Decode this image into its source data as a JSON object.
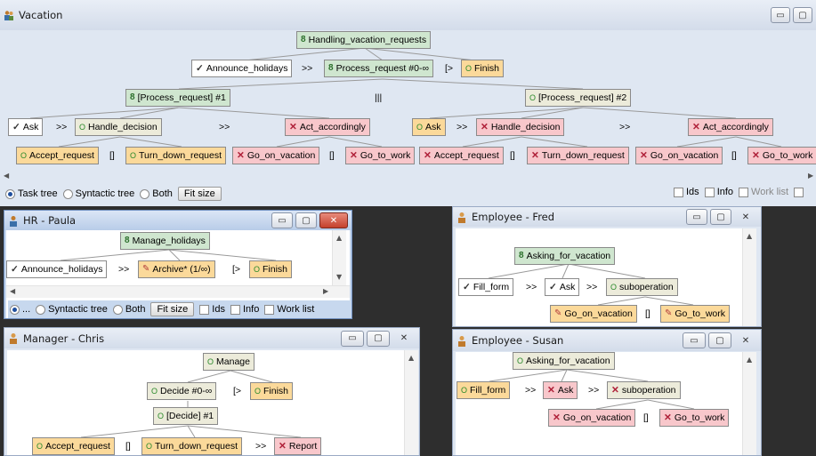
{
  "vacation": {
    "title": "Vacation",
    "controls": {
      "minimize": "▭",
      "maximize": "▢"
    },
    "nodes": {
      "root": "Handling_vacation_requests",
      "announce": "Announce_holidays",
      "op1": ">>",
      "process_request": "Process_request #0-∞",
      "op2": "[>",
      "finish": "Finish",
      "pr1": "[Process_request] #1",
      "parallel": "|||",
      "pr2": "[Process_request] #2",
      "ask1": "Ask",
      "op3": ">>",
      "handle1": "Handle_decision",
      "op4": ">>",
      "act1": "Act_accordingly",
      "ask2": "Ask",
      "op5": ">>",
      "handle2": "Handle_decision",
      "op6": ">>",
      "act2": "Act_accordingly",
      "accept1": "Accept_request",
      "op7": "[]",
      "turndown1": "Turn_down_request",
      "goon1": "Go_on_vacation",
      "op8": "[]",
      "gowork1": "Go_to_work",
      "accept2": "Accept_request",
      "op9": "[]",
      "turndown2": "Turn_down_request",
      "goon2": "Go_on_vacation",
      "op10": "[]",
      "gowork2": "Go_to_work"
    },
    "bar": {
      "task_tree": "Task tree",
      "syntactic_tree": "Syntactic tree",
      "both": "Both",
      "fit_size": "Fit size",
      "ids": "Ids",
      "info": "Info",
      "work_list": "Work list"
    }
  },
  "hr": {
    "title": "HR - Paula",
    "nodes": {
      "root": "Manage_holidays",
      "announce": "Announce_holidays",
      "op1": ">>",
      "archive": "Archive* (1/∞)",
      "op2": "[>",
      "finish": "Finish"
    },
    "bar": {
      "task_tree": "...",
      "syntactic_tree": "Syntactic tree",
      "both": "Both",
      "fit_size": "Fit size",
      "ids": "Ids",
      "info": "Info",
      "work_list": "Work list"
    }
  },
  "fred": {
    "title": "Employee - Fred",
    "nodes": {
      "root": "Asking_for_vacation",
      "fill": "Fill_form",
      "op1": ">>",
      "ask": "Ask",
      "op2": ">>",
      "subop": "suboperation",
      "goon": "Go_on_vacation",
      "op3": "[]",
      "gowork": "Go_to_work"
    }
  },
  "chris": {
    "title": "Manager - Chris",
    "nodes": {
      "root": "Manage",
      "decide": "Decide #0-∞",
      "op1": "[>",
      "finish": "Finish",
      "decide1": "[Decide] #1",
      "accept": "Accept_request",
      "op2": "[]",
      "turndown": "Turn_down_request",
      "op3": ">>",
      "report": "Report"
    }
  },
  "susan": {
    "title": "Employee - Susan",
    "nodes": {
      "root": "Asking_for_vacation",
      "fill": "Fill_form",
      "op1": ">>",
      "ask": "Ask",
      "op2": ">>",
      "subop": "suboperation",
      "goon": "Go_on_vacation",
      "op3": "[]",
      "gowork": "Go_to_work"
    }
  }
}
